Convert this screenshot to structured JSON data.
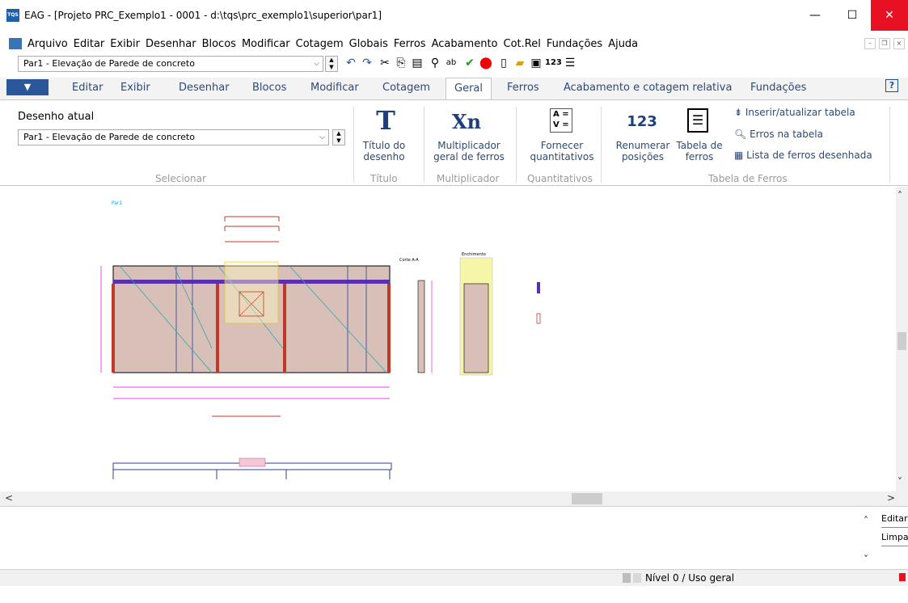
{
  "window": {
    "app_icon": "TQS",
    "title": "EAG - [Projeto PRC_Exemplo1 - 0001 - d:\\tqs\\prc_exemplo1\\superior\\par1]",
    "minimize": "—",
    "maximize": "☐",
    "close": "✕"
  },
  "menu": [
    "Arquivo",
    "Editar",
    "Exibir",
    "Desenhar",
    "Blocos",
    "Modificar",
    "Cotagem",
    "Globais",
    "Ferros",
    "Acabamento",
    "Cot.Rel",
    "Fundações",
    "Ajuda"
  ],
  "quick_toolbar": {
    "drawing_combo": "Par1 - Elevação de Parede de concreto",
    "icons": [
      "undo-icon",
      "redo-icon",
      "cut-icon",
      "copy-icon",
      "paste-icon",
      "find-icon",
      "replace-icon",
      "check-icon",
      "stop-icon",
      "new-icon",
      "open-icon",
      "save-icon",
      "numbering-icon",
      "table-icon"
    ]
  },
  "ribbon_tabs": {
    "file": "▼",
    "tabs": [
      "Editar",
      "Exibir",
      "Desenhar",
      "Blocos",
      "Modificar",
      "Cotagem",
      "Geral",
      "Ferros",
      "Acabamento e cotagem relativa",
      "Fundações"
    ],
    "active": "Geral",
    "help": "?"
  },
  "ribbon": {
    "current_drawing_label": "Desenho atual",
    "current_drawing_value": "Par1 - Elevação de Parede de concreto",
    "group_select": "Selecionar",
    "titulo_icon_text": "T",
    "titulo_btn": [
      "Título do",
      "desenho"
    ],
    "group_titulo": "Título",
    "mult_icon_text": "Xn",
    "mult_btn": [
      "Multiplicador",
      "geral de ferros"
    ],
    "group_mult": "Multiplicador",
    "quant_icon_text": "A =\nV =",
    "quant_btn": [
      "Fornecer",
      "quantitativos"
    ],
    "group_quant": "Quantitativos",
    "renum_icon_text": "123",
    "renum_btn": [
      "Renumerar",
      "posições"
    ],
    "tabela_btn": [
      "Tabela de",
      "ferros"
    ],
    "inserir_tabela": "Inserir/atualizar tabela",
    "erros_tabela": "Erros na tabela",
    "lista_ferros": "Lista de ferros desenhada",
    "group_tabela": "Tabela de Ferros"
  },
  "drawing": {
    "title_label": "Par1",
    "section_label": "Corte A-A",
    "detail_label": "Enchimento"
  },
  "command_area": {
    "edit_button": "Editar",
    "clear_button": "Limpa"
  },
  "status": {
    "level_text": "Nível 0 / Uso geral"
  },
  "colors": {
    "accent": "#2b579a",
    "close": "#e81123",
    "wall_fill": "#d8c0b8",
    "beam_band": "#5b2fb0",
    "column": "#c0392b",
    "dimension": "#e000e0",
    "detail_fill": "#f5f6a8"
  }
}
